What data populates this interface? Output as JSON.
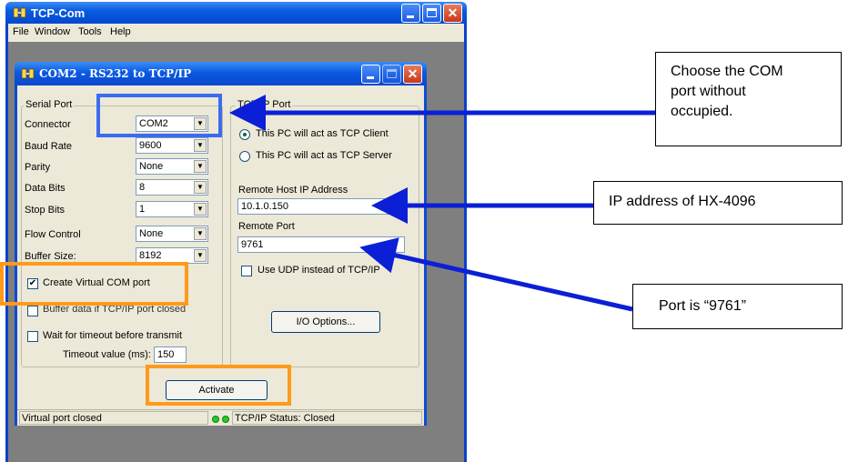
{
  "outer_window": {
    "title": "TCP-Com"
  },
  "menu": [
    "File",
    "Window",
    "Tools",
    "Help"
  ],
  "inner_window": {
    "title": "COM2 - RS232 to TCP/IP"
  },
  "serial_port": {
    "group_title": "Serial Port",
    "connector": {
      "label": "Connector",
      "value": "COM2"
    },
    "baud_rate": {
      "label": "Baud Rate",
      "value": "9600"
    },
    "parity": {
      "label": "Parity",
      "value": "None"
    },
    "data_bits": {
      "label": "Data Bits",
      "value": "8"
    },
    "stop_bits": {
      "label": "Stop Bits",
      "value": "1"
    },
    "flow_control": {
      "label": "Flow Control",
      "value": "None"
    },
    "buffer_size": {
      "label": "Buffer Size:",
      "value": "8192"
    },
    "create_virtual_com": {
      "label": "Create Virtual COM port",
      "checked": true
    },
    "buffer_data": {
      "label": "Buffer data if TCP/IP port closed",
      "checked": false
    },
    "wait_timeout": {
      "label": "Wait for timeout before transmit",
      "checked": false
    },
    "timeout_value": {
      "label": "Timeout value (ms):",
      "value": "150"
    }
  },
  "tcp_port": {
    "group_title": "TCP/IP Port",
    "radio_client": {
      "label": "This PC will act as TCP Client",
      "selected": true
    },
    "radio_server": {
      "label": "This PC will act as TCP Server",
      "selected": false
    },
    "remote_host": {
      "label": "Remote Host IP Address",
      "value": "10.1.0.150"
    },
    "remote_port": {
      "label": "Remote Port",
      "value": "9761"
    },
    "use_udp": {
      "label": "Use UDP instead of TCP/IP",
      "checked": false
    },
    "io_options_label": "I/O Options..."
  },
  "activate_label": "Activate",
  "status_bar": {
    "left": "Virtual port closed",
    "right": "TCP/IP Status: Closed",
    "led_color": "#22cc22"
  },
  "callouts": {
    "com_lines": [
      "Choose the COM",
      "port without",
      "occupied."
    ],
    "ip": "IP address of HX-4096",
    "port": "Port is “9761”"
  },
  "colors": {
    "highlight_blue": "#3b6cf0",
    "highlight_orange": "#ff9a1a",
    "arrow": "#0a1fd6"
  }
}
